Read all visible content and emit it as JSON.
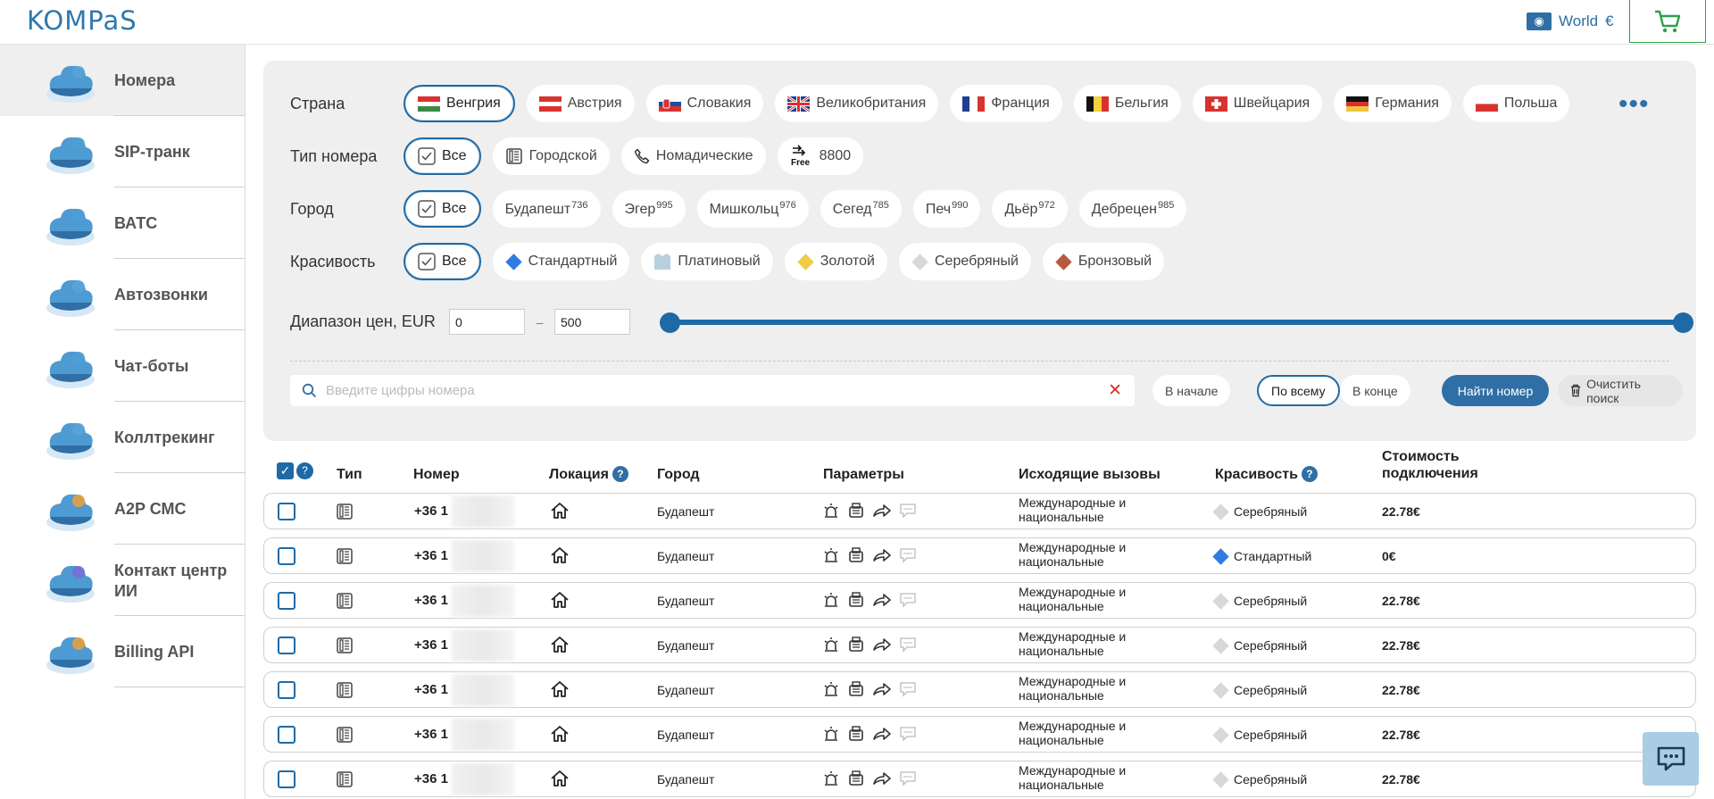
{
  "header": {
    "logo": "KOMPaS",
    "region": "World",
    "currency": "€"
  },
  "sidebar": {
    "items": [
      {
        "label": "Номера",
        "active": true
      },
      {
        "label": "SIP-транк"
      },
      {
        "label": "ВАТС"
      },
      {
        "label": "Автозвонки"
      },
      {
        "label": "Чат-боты"
      },
      {
        "label": "Коллтрекинг"
      },
      {
        "label": "A2P СМС"
      },
      {
        "label": "Контакт центр ИИ"
      },
      {
        "label": "Billing API"
      }
    ]
  },
  "filters": {
    "country_label": "Страна",
    "countries": [
      "Венгрия",
      "Австрия",
      "Словакия",
      "Великобритания",
      "Франция",
      "Бельгия",
      "Швейцария",
      "Германия",
      "Польша"
    ],
    "type_label": "Тип номера",
    "types": [
      "Все",
      "Городской",
      "Номадические",
      "8800"
    ],
    "type_free_badge": "Free",
    "city_label": "Город",
    "cities": [
      {
        "name": "Все",
        "code": ""
      },
      {
        "name": "Будапешт",
        "code": "736"
      },
      {
        "name": "Эгер",
        "code": "995"
      },
      {
        "name": "Мишкольц",
        "code": "976"
      },
      {
        "name": "Сегед",
        "code": "785"
      },
      {
        "name": "Печ",
        "code": "990"
      },
      {
        "name": "Дьёр",
        "code": "972"
      },
      {
        "name": "Дебрецен",
        "code": "985"
      }
    ],
    "beauty_label": "Красивость",
    "beauty": [
      "Все",
      "Стандартный",
      "Платиновый",
      "Золотой",
      "Серебряный",
      "Бронзовый"
    ],
    "beauty_colors": {
      "Стандартный": "#2f7be0",
      "Платиновый": "#b9cfdc",
      "Золотой": "#f0cc4a",
      "Серебряный": "#d8d8d8",
      "Бронзовый": "#b75a3f"
    },
    "price_label": "Диапазон цен, EUR",
    "price_min": "0",
    "price_max": "500",
    "price_dash": "–",
    "slider": {
      "min": 0,
      "max": 500,
      "low": 0,
      "high": 500
    }
  },
  "search": {
    "placeholder": "Введите цифры номера",
    "value": "",
    "positions": [
      "В начале",
      "По всему",
      "В конце"
    ],
    "selected_position": "По всему",
    "find_label": "Найти номер",
    "clear_label": "Очистить поиск"
  },
  "table": {
    "headers": {
      "type": "Тип",
      "number": "Номер",
      "location": "Локация",
      "city": "Город",
      "params": "Параметры",
      "outgoing": "Исходящие вызовы",
      "beauty": "Красивость",
      "cost": "Стоимость подключения"
    },
    "rows": [
      {
        "number": "+36 1",
        "city": "Будапешт",
        "outgoing": "Международные и национальные",
        "beauty": "Серебряный",
        "price": "22.78€"
      },
      {
        "number": "+36 1",
        "city": "Будапешт",
        "outgoing": "Международные и национальные",
        "beauty": "Стандартный",
        "price": "0€"
      },
      {
        "number": "+36 1",
        "city": "Будапешт",
        "outgoing": "Международные и национальные",
        "beauty": "Серебряный",
        "price": "22.78€"
      },
      {
        "number": "+36 1",
        "city": "Будапешт",
        "outgoing": "Международные и национальные",
        "beauty": "Серебряный",
        "price": "22.78€"
      },
      {
        "number": "+36 1",
        "city": "Будапешт",
        "outgoing": "Международные и национальные",
        "beauty": "Серебряный",
        "price": "22.78€"
      },
      {
        "number": "+36 1",
        "city": "Будапешт",
        "outgoing": "Международные и национальные",
        "beauty": "Серебряный",
        "price": "22.78€"
      },
      {
        "number": "+36 1",
        "city": "Будапешт",
        "outgoing": "Международные и национальные",
        "beauty": "Серебряный",
        "price": "22.78€"
      }
    ]
  },
  "colors": {
    "accent": "#1f6aa5",
    "cart": "#2fa04a",
    "clear_x": "#d9322e"
  }
}
